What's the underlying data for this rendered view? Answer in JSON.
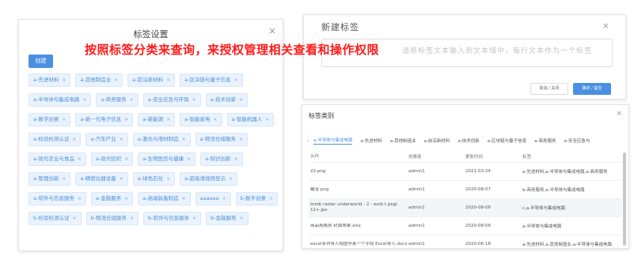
{
  "banner": "按照标签分类来查询，来授权管理相关查看和操作权限",
  "left_panel": {
    "title": "标签设置",
    "close": "×",
    "add_button": "创建",
    "tags": [
      "a-先进材料",
      "a-其他制造业",
      "a-前沿新材料",
      "a-区块链与量子信息",
      "a-半导体与集成电路",
      "a-商务服务",
      "a-安全应急与环保",
      "a-技术创新",
      "a-数字创意",
      "a-新一代电子信息",
      "a-新能源",
      "a-智能家电",
      "a-智能机器人",
      "a-检验检测认证",
      "a-汽车产业",
      "a-激光与增材制造",
      "a-物流仓储服务",
      "a-现代农业与食品",
      "a-现代纺织",
      "a-生物医药与健康",
      "a-知识创新",
      "a-管理创新",
      "a-精密仪器设备",
      "a-绿色石化",
      "a-超高清视频显示",
      "a-软件与信息服务",
      "a-金融服务",
      "a-高端装备制造",
      "aaaaaa",
      "b-数字创意",
      "b-检验检测认证",
      "b-物流仓储服务",
      "b-软件与信息服务",
      "b-金融服务"
    ],
    "tag_close": "×"
  },
  "new_dialog": {
    "title": "新建标签",
    "close": "×",
    "placeholder": "请将标签文本输入到文本域中，每行文本作为一个标签",
    "cancel": "取消 / 关闭",
    "ok": "确定 / 提交"
  },
  "category_panel": {
    "title": "标签类别",
    "close": "×",
    "prev": "‹",
    "next": "›",
    "tabs": [
      "a-半导体与集成电路",
      "a-先进材料",
      "a-其他制造业",
      "a-前沿新材料",
      "a-技术创新",
      "a-区块链与量子信息",
      "a-商务服务",
      "a-安全应急与"
    ],
    "columns": [
      "名称",
      "创建者",
      "更新时间",
      "标签"
    ],
    "rows": [
      [
        "22.png",
        "admin1",
        "2021-03-24",
        "a-先进材料,a-半导体与集成电路,a-商务服务"
      ],
      [
        "糖宝.png",
        "admin1",
        "2020-08-07",
        "b-商务服务,a-半导体与集成电路"
      ],
      [
        "tomb raider underworld - 2 - exrb t pegi 12+.jpx",
        "admin1",
        "2020-08-06",
        "c,a-半导体与集成电路"
      ],
      [
        "商品规格表 封面效果.xlsx",
        "admin1",
        "2020-08-06",
        "a-半导体与集成电路"
      ],
      [
        "excel多列导入视图中某一个字段 Excel导入.docx",
        "admin1",
        "2020-06-18",
        "a-先进材料,a-其他制造业,a-半导体与集成电路"
      ]
    ]
  }
}
